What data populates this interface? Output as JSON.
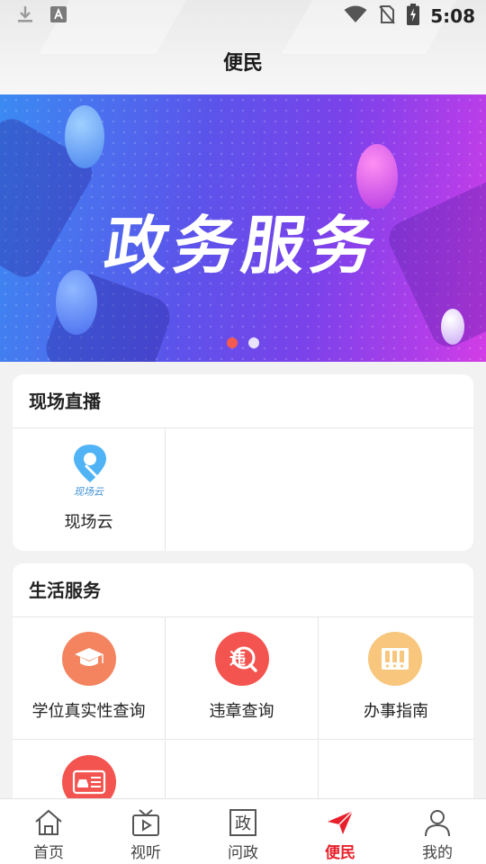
{
  "status_bar": {
    "time": "5:08",
    "icons": [
      "download-icon",
      "text-a-icon",
      "wifi-icon",
      "no-sim-icon",
      "battery-charging-icon"
    ]
  },
  "header": {
    "title": "便民"
  },
  "banner": {
    "title": "政务服务",
    "slide_count": 2,
    "active_slide": 1,
    "colors": {
      "start": "#3b8af2",
      "mid": "#6a4aea",
      "end": "#d33de6"
    }
  },
  "live_section": {
    "title": "现场直播",
    "items": [
      {
        "label": "现场云",
        "logo_text": "现场云",
        "icon": "location-pin-icon",
        "color": "#4fb3f5"
      }
    ]
  },
  "life_section": {
    "title": "生活服务",
    "items": [
      {
        "label": "学位真实性查询",
        "icon": "graduation-cap-icon",
        "color": "#f3845f"
      },
      {
        "label": "违章查询",
        "icon": "violation-search-icon",
        "color": "#f4544f"
      },
      {
        "label": "办事指南",
        "icon": "guide-binders-icon",
        "color": "#f8c67d"
      },
      {
        "label": "",
        "icon": "driver-license-icon",
        "color": "#f4544f"
      }
    ]
  },
  "bottom_nav": {
    "active_color": "#e8202b",
    "items": [
      {
        "label": "首页",
        "icon": "home-icon",
        "active": false
      },
      {
        "label": "视听",
        "icon": "tv-icon",
        "active": false
      },
      {
        "label": "问政",
        "icon": "zheng-box-icon",
        "icon_text": "政",
        "active": false
      },
      {
        "label": "便民",
        "icon": "paper-plane-icon",
        "active": true
      },
      {
        "label": "我的",
        "icon": "user-icon",
        "active": false
      }
    ]
  }
}
